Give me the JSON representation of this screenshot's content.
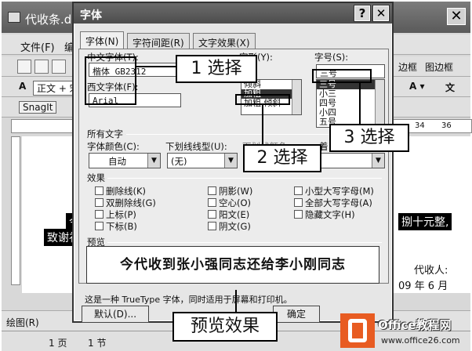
{
  "word": {
    "title": "代收条.do",
    "menu": [
      "文件(F)",
      "编辑"
    ],
    "style_box": "正文 + 宋",
    "snagit": "SnagIt",
    "right_toolbar": [
      "边框",
      "图边框"
    ],
    "ruler_nums": [
      "34",
      "36"
    ],
    "doc_left_hl_1": "今",
    "doc_left_hl_2": "致谢礼",
    "doc_right_hl": "捌十元整,",
    "doc_receiver": "代收人:",
    "doc_date": "09 年 6 月",
    "draw_label": "绘图(R)",
    "status_page": "1 页",
    "status_section": "1 节"
  },
  "dialog": {
    "title": "字体",
    "help_btn": "?",
    "close_btn": "✕",
    "tabs": [
      "字体(N)",
      "字符间距(R)",
      "文字效果(X)"
    ],
    "chinese_font_label": "中文字体(T):",
    "chinese_font_value": "楷体_GB2312",
    "western_font_label": "西文字体(F):",
    "western_font_value": "Arial",
    "style_label": "字形(Y):",
    "style_items": [
      "倾斜",
      "加粗",
      "加粗 倾斜"
    ],
    "size_label": "字号(S):",
    "size_value": "三号",
    "size_items": [
      "三号",
      "小三",
      "四号",
      "小四",
      "五号"
    ],
    "all_text": "所有文字",
    "font_color_label": "字体颜色(C):",
    "font_color_value": "自动",
    "underline_label": "下划线线型(U):",
    "underline_value": "(无)",
    "underline_color_label": "下划线颜色",
    "emphasis_label": "着",
    "effects_label": "效果",
    "effects": [
      [
        "删除线(K)",
        "阴影(W)",
        "小型大写字母(M)"
      ],
      [
        "双删除线(G)",
        "空心(O)",
        "全部大写字母(A)"
      ],
      [
        "上标(P)",
        "阳文(E)",
        "隐藏文字(H)"
      ],
      [
        "下标(B)",
        "阴文(G)"
      ]
    ],
    "preview_label": "预览",
    "preview_text": "今代收到张小强同志还给李小刚同志",
    "truetype_note": "这是一种 TrueType 字体，同时适用于屏幕和打印机。",
    "default_button": "默认(D)...",
    "ok_button": "确定"
  },
  "callouts": {
    "step1": "1 选择",
    "step2": "2 选择",
    "step3": "3 选择",
    "preview": "预览效果"
  },
  "logo": {
    "name": "Office教程网",
    "url": "www.office26.com"
  }
}
